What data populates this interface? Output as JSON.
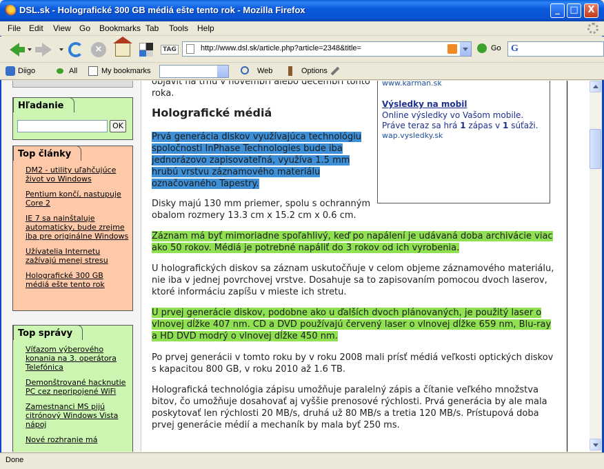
{
  "window": {
    "title": "DSL.sk - Holografické 300 GB médiá ešte tento rok - Mozilla Firefox",
    "buttons": [
      "_",
      "□",
      "X"
    ]
  },
  "menu": {
    "items": [
      "File",
      "Edit",
      "View",
      "Go",
      "Bookmarks",
      "Tab",
      "Tools",
      "Help"
    ]
  },
  "navbar": {
    "url": "http://www.dsl.sk/article.php?article=2348&title=",
    "go_label": "Go",
    "tag_label": "TAG",
    "search_icon_label": "G"
  },
  "bookmarks_bar": {
    "diigo": "Diigo",
    "all": "All",
    "my_bookmarks": "My bookmarks",
    "web": "Web",
    "options": "Options"
  },
  "sidebar": {
    "search": {
      "title": "Hľadanie",
      "ok": "OK"
    },
    "top_clanky": {
      "title": "Top články",
      "items": [
        "DM2 - utility uľahčujúce život vo Windows",
        "Pentium končí, nastupuje Core 2",
        "IE 7 sa nainštaluje automaticky, bude zrejme iba pre originálne Windows",
        "Užívatelia Internetu zažívajú menej stresu",
        "Holografické 300 GB médiá ešte tento rok"
      ]
    },
    "top_spravy": {
      "title": "Top správy",
      "items": [
        "Víťazom výberového konania na 3. operátora Telefónica",
        "Demonštrované hacknutie PC cez nepripojené WiFi",
        "Zamestnanci MS pijú citrónový Windows Vista nápoj",
        "Nové rozhranie má"
      ]
    }
  },
  "article": {
    "intro_fragment": "objaviť na trhu v novembri alebo decembri tohto roka.",
    "heading": "Holografické médiá",
    "p1": "Prvá generácia diskov využívajúca technológiu spoločnosti InPhase Technologies bude iba jednorázovo zapisovateľná, využíva 1.5 mm hrubú vrstvu záznamového materiálu označovaného Tapestry.",
    "p2": "Disky majú 130 mm priemer, spolu s ochranným obalom rozmery 13.3 cm x 15.2 cm x 0.6 cm.",
    "p3": "Záznam má byť mimoriadne spoľahlivý, keď po napálení je udávaná doba archivácie viac ako 50 rokov. Médiá je potrebné napáliť do 3 rokov od ich vyrobenia.",
    "p4": "U holografických diskov sa záznam uskutočňuje v celom objeme záznamového materiálu, nie iba v jednej povrchovej vrstve. Dosahuje sa to zapisovaním pomocou dvoch laserov, ktoré informáciu zapíšu v mieste ich stretu.",
    "p5": "U prvej generácie diskov, podobne ako u ďalších dvoch plánovaných, je použitý laser o vlnovej dĺžke 407 nm. CD a DVD používajú červený laser o vlnovej dĺžke 659 nm, Blu-ray a HD DVD modrý o vlnovej dĺžke 450 nm.",
    "p6": "Po prvej generácii v tomto roku by v roku 2008 mali prísť médiá veľkosti optických diskov s kapacitou 800 GB, v roku 2010 až 1.6 TB.",
    "p7": "Holografická technológia zápisu umožňuje paralelný zápis a čítanie veľkého množstva bitov, čo umožňuje dosahovať aj vyššie prenosové rýchlosti. Prvá generácia by ale mala poskytovať len rýchlosti 20 MB/s, druhá už 80 MB/s a tretia 120 MB/s. Prístupová doba prvej generácie médií a mechaník by mala byť 250 ms."
  },
  "ad": {
    "url1": "www.karman.sk",
    "title": "Výsledky na mobil",
    "desc_a": "Online výsledky vo Vašom mobile. Práve teraz sa hrá ",
    "desc_b1": "1",
    "desc_c": " zápas v ",
    "desc_b2": "1",
    "desc_d": " súťaži.",
    "url2": "wap.vysledky.sk"
  },
  "status": {
    "text": "Done"
  },
  "colors": {
    "title_bar": "#0A53D2",
    "green_box": "#CCF5B2",
    "orange_box": "#FEC9A8",
    "highlight_blue": "#3D90D7",
    "highlight_green": "#8FE152"
  }
}
